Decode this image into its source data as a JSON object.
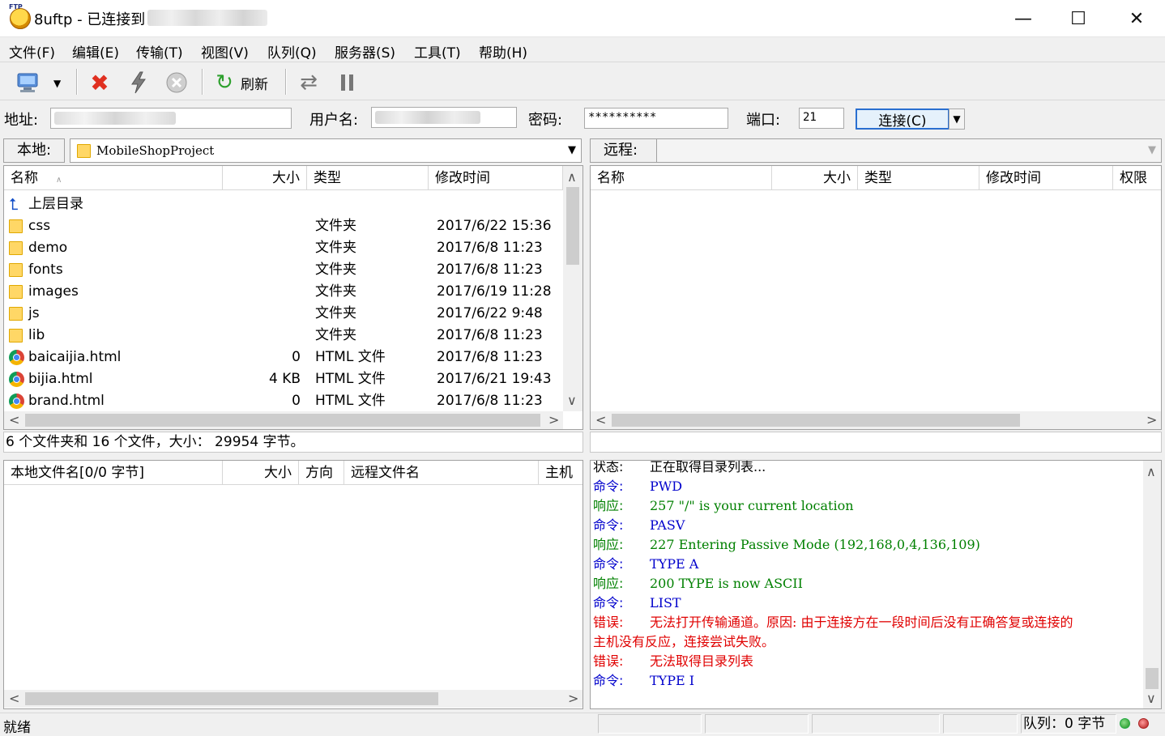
{
  "window": {
    "title": "8uftp - 已连接到",
    "controls": {
      "minimize": "—",
      "maximize": "☐",
      "close": "✕"
    }
  },
  "menu": [
    "文件(F)",
    "编辑(E)",
    "传输(T)",
    "视图(V)",
    "队列(Q)",
    "服务器(S)",
    "工具(T)",
    "帮助(H)"
  ],
  "toolbar": {
    "refresh_label": "刷新"
  },
  "address": {
    "address_label": "地址:",
    "user_label": "用户名:",
    "password_label": "密码:",
    "password_value": "**********",
    "port_label": "端口:",
    "port_value": "21",
    "connect_label": "连接(C)"
  },
  "local": {
    "label": "本地:",
    "path": "MobileShopProject",
    "columns": [
      "名称",
      "大小",
      "类型",
      "修改时间"
    ],
    "up_label": "上层目录",
    "files": [
      {
        "name": "css",
        "size": "",
        "type": "文件夹",
        "modified": "2017/6/22 15:36",
        "icon": "folder-icon"
      },
      {
        "name": "demo",
        "size": "",
        "type": "文件夹",
        "modified": "2017/6/8 11:23",
        "icon": "folder-icon"
      },
      {
        "name": "fonts",
        "size": "",
        "type": "文件夹",
        "modified": "2017/6/8 11:23",
        "icon": "folder-icon"
      },
      {
        "name": "images",
        "size": "",
        "type": "文件夹",
        "modified": "2017/6/19 11:28",
        "icon": "folder-icon"
      },
      {
        "name": "js",
        "size": "",
        "type": "文件夹",
        "modified": "2017/6/22 9:48",
        "icon": "folder-icon"
      },
      {
        "name": "lib",
        "size": "",
        "type": "文件夹",
        "modified": "2017/6/8 11:23",
        "icon": "folder-icon"
      },
      {
        "name": "baicaijia.html",
        "size": "0",
        "type": "HTML 文件",
        "modified": "2017/6/8 11:23",
        "icon": "chrome-icon"
      },
      {
        "name": "bijia.html",
        "size": "4 KB",
        "type": "HTML 文件",
        "modified": "2017/6/21 19:43",
        "icon": "chrome-icon"
      },
      {
        "name": "brand.html",
        "size": "0",
        "type": "HTML 文件",
        "modified": "2017/6/8 11:23",
        "icon": "chrome-icon"
      }
    ],
    "summary": "6 个文件夹和 16 个文件，大小： 29954 字节。"
  },
  "remote": {
    "label": "远程:",
    "columns": [
      "名称",
      "大小",
      "类型",
      "修改时间",
      "权限"
    ]
  },
  "queue": {
    "columns": [
      "本地文件名[0/0 字节]",
      "大小",
      "方向",
      "远程文件名",
      "主机"
    ]
  },
  "log": [
    {
      "kind": "状态:",
      "msg": "正在取得目录列表...",
      "color": "#000000"
    },
    {
      "kind": "命令:",
      "msg": "PWD",
      "color": "#0000cc"
    },
    {
      "kind": "响应:",
      "msg": "257 \"/\" is your current location",
      "color": "#008000"
    },
    {
      "kind": "命令:",
      "msg": "PASV",
      "color": "#0000cc"
    },
    {
      "kind": "响应:",
      "msg": "227 Entering Passive Mode (192,168,0,4,136,109)",
      "color": "#008000"
    },
    {
      "kind": "命令:",
      "msg": "TYPE A",
      "color": "#0000cc"
    },
    {
      "kind": "响应:",
      "msg": "200 TYPE is now ASCII",
      "color": "#008000"
    },
    {
      "kind": "命令:",
      "msg": "LIST",
      "color": "#0000cc"
    },
    {
      "kind": "错误:",
      "msg": "无法打开传输通道。原因: 由于连接方在一段时间后没有正确答复或连接的",
      "color": "#e00000"
    },
    {
      "kind": "",
      "msg": "主机没有反应，连接尝试失败。",
      "color": "#e00000"
    },
    {
      "kind": "错误:",
      "msg": "无法取得目录列表",
      "color": "#e00000"
    },
    {
      "kind": "命令:",
      "msg": "TYPE I",
      "color": "#0000cc"
    }
  ],
  "status": {
    "ready": "就绪",
    "queue": "队列：0 字节"
  }
}
